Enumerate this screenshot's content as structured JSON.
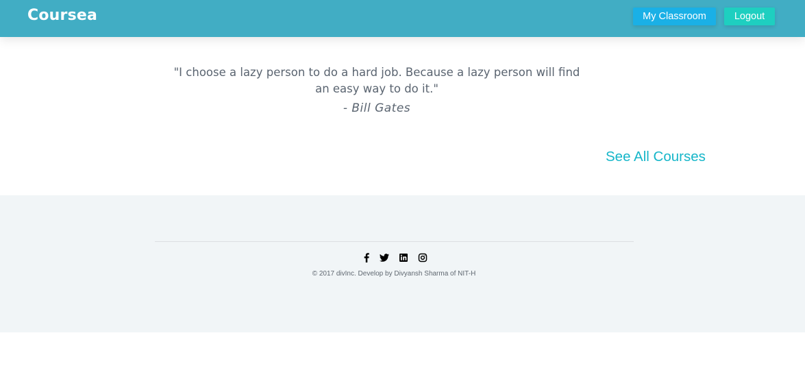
{
  "header": {
    "brand": "Coursea",
    "buttons": {
      "classroom_label": "My Classroom",
      "logout_label": "Logout"
    }
  },
  "quote": {
    "text": "\"I choose a lazy person to do a hard job. Because a lazy person will find an easy way to do it.\"",
    "author": "- Bill Gates"
  },
  "courses_link": "See All Courses",
  "footer": {
    "socials": [
      "facebook-icon",
      "twitter-icon",
      "linkedin-icon",
      "instagram-icon"
    ],
    "copyright": "© 2017 divInc. Develop by Divyansh Sharma of NIT-H"
  },
  "colors": {
    "navbar": "#41adc4",
    "classroom_button": "#1ab0e6",
    "logout_button": "#1ecfc0",
    "link": "#16b6c9",
    "footer_bg": "#f1f5f7"
  }
}
